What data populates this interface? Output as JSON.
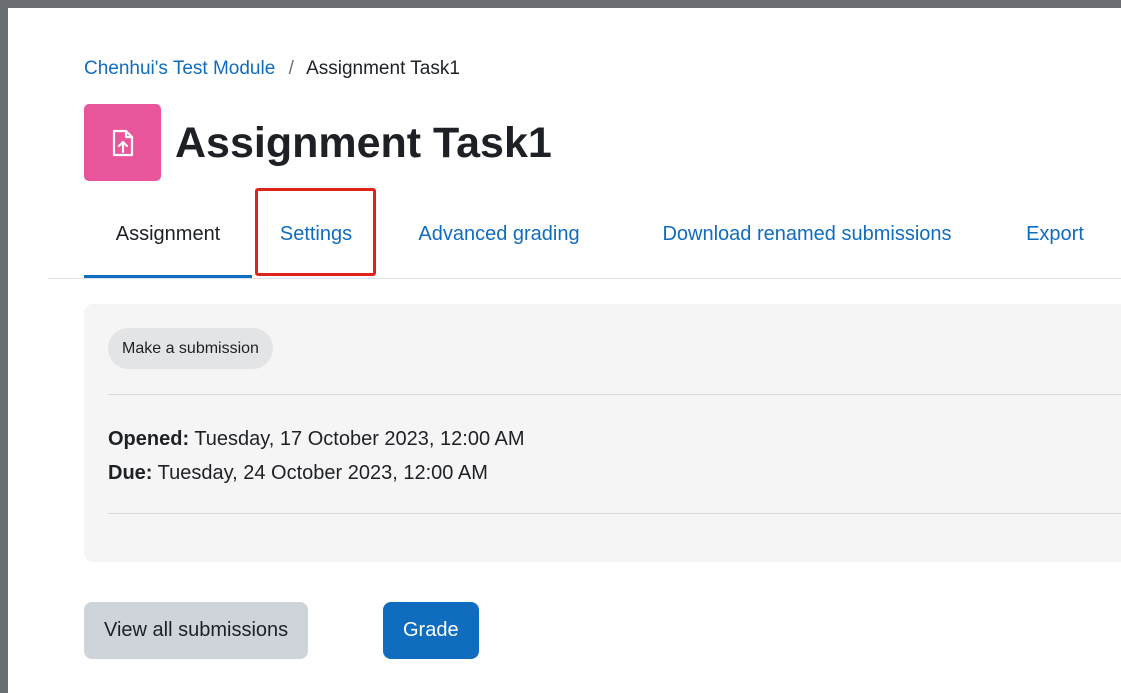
{
  "breadcrumb": {
    "course": "Chenhui's Test Module",
    "separator": "/",
    "current": "Assignment Task1"
  },
  "header": {
    "icon": "file-upload-icon",
    "icon_color": "#e9559b",
    "title": "Assignment Task1"
  },
  "tabs": [
    {
      "label": "Assignment",
      "active": true
    },
    {
      "label": "Settings",
      "active": false,
      "highlighted": true
    },
    {
      "label": "Advanced grading",
      "active": false
    },
    {
      "label": "Download renamed submissions",
      "active": false
    },
    {
      "label": "Export",
      "active": false
    }
  ],
  "panel": {
    "submission_button": "Make a submission",
    "opened_label": "Opened:",
    "opened_value": "Tuesday, 17 October 2023, 12:00 AM",
    "due_label": "Due:",
    "due_value": "Tuesday, 24 October 2023, 12:00 AM"
  },
  "actions": {
    "view_all": "View all submissions",
    "grade": "Grade"
  },
  "colors": {
    "link": "#0f6cbf",
    "primary": "#0f6cbf",
    "highlight": "#e0221c",
    "frame": "#6a6e73"
  }
}
